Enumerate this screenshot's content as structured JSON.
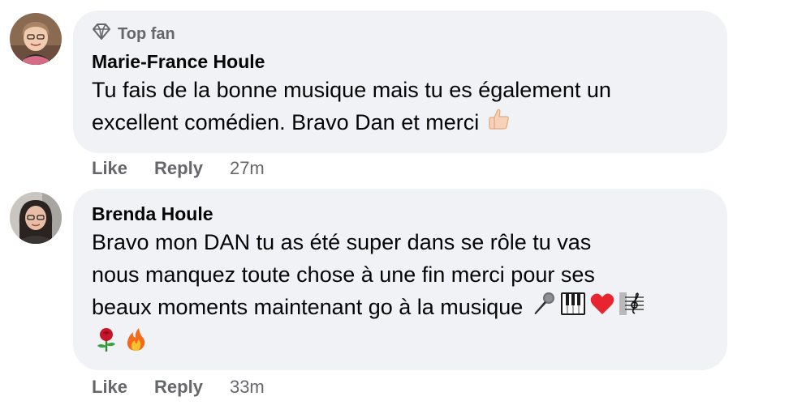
{
  "comments": [
    {
      "badge": "Top fan",
      "author": "Marie-France Houle",
      "text_lines": [
        "Tu fais de la bonne musique mais tu es également un",
        "excellent comédien. Bravo Dan et merci"
      ],
      "actions": {
        "like": "Like",
        "reply": "Reply",
        "time": "27m"
      }
    },
    {
      "author": "Brenda Houle",
      "text_lines": [
        "Bravo mon DAN tu as été super dans se rôle tu vas",
        "nous manquez toute chose à une fin merci pour ses",
        "beaux moments maintenant go à la musique"
      ],
      "actions": {
        "like": "Like",
        "reply": "Reply",
        "time": "33m"
      }
    }
  ],
  "emojis": {
    "c1": [
      "thumbs-up"
    ],
    "c2_line3": [
      "microphone",
      "piano-keys",
      "red-heart",
      "musical-score"
    ],
    "c2_line4": [
      "rose",
      "fire"
    ]
  },
  "colors": {
    "bubble": "#f0f2f5",
    "meta": "#65676b",
    "text": "#050505"
  }
}
